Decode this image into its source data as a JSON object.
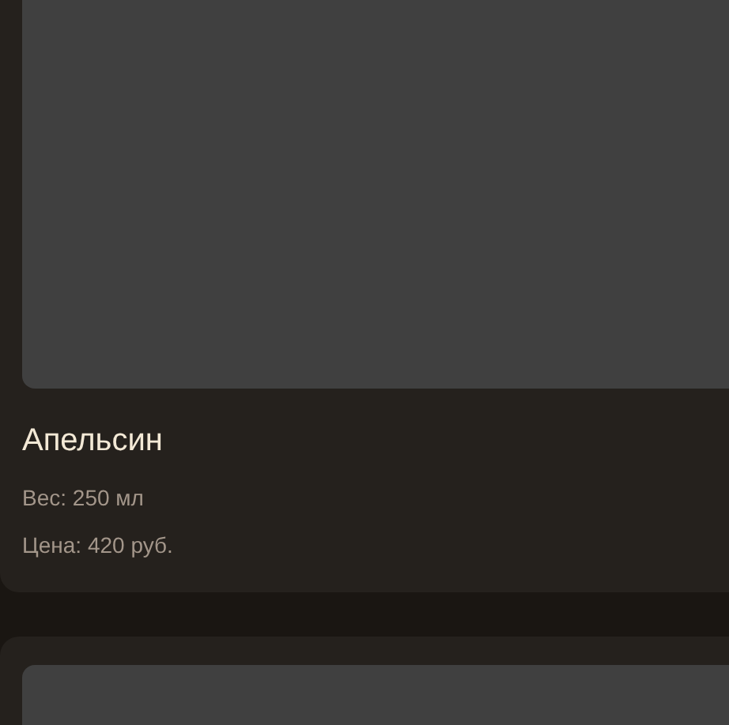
{
  "products": [
    {
      "kind": "full",
      "name": "Апельсин",
      "weight": "Вес: 250 мл",
      "price": "Цена: 420 руб."
    },
    {
      "kind": "partial"
    }
  ]
}
